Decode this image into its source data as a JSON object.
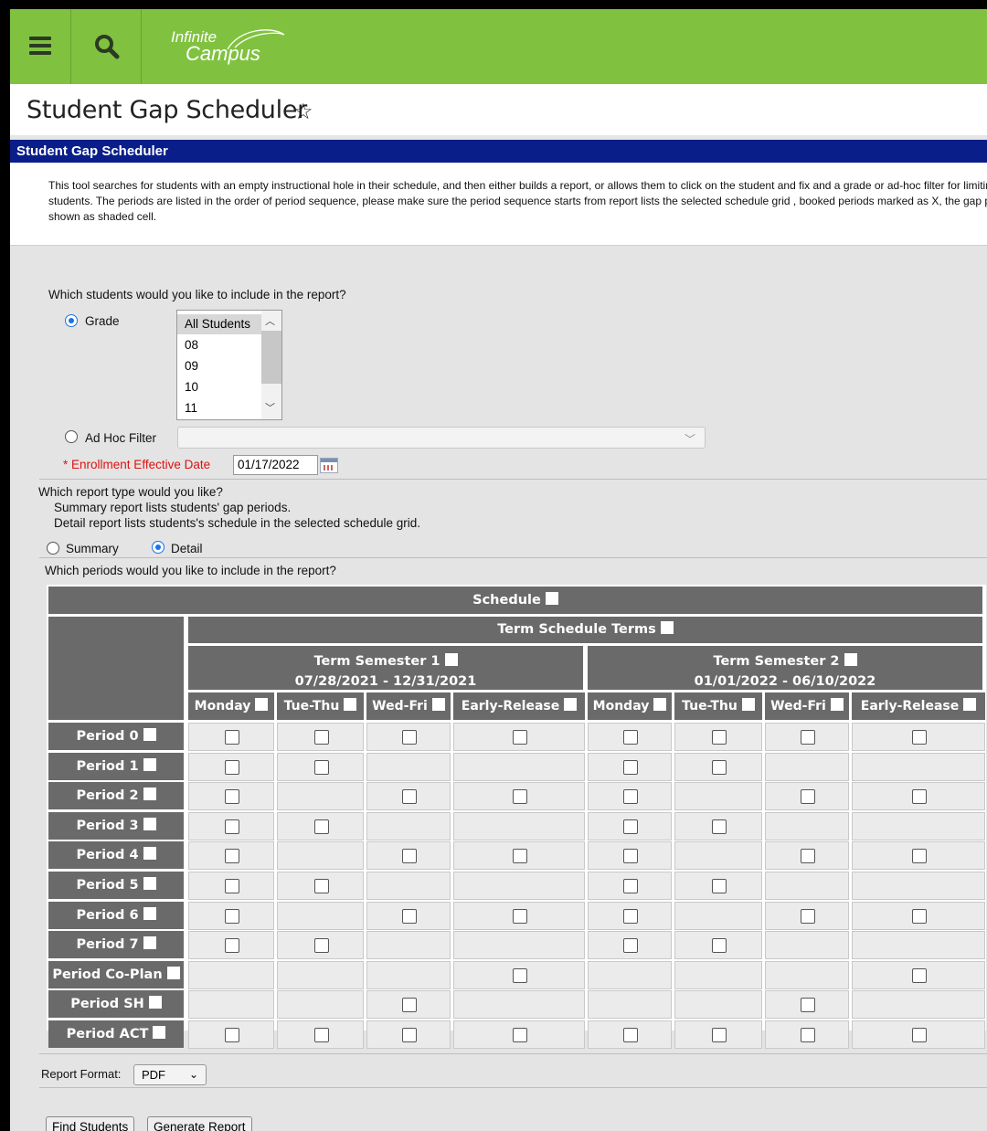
{
  "app": {
    "logo_line1": "Infinite",
    "logo_line2": "Campus"
  },
  "page": {
    "title": "Student Gap Scheduler",
    "section_header": "Student Gap Scheduler",
    "description": "This tool searches for students with an empty instructional hole in their schedule, and then either builds a report, or allows them to click on the student and fix and a grade or ad-hoc filter for limiting the students. The periods are listed in the order of period sequence, please make sure the period sequence starts from report lists the selected schedule grid , booked periods marked as X, the gap periods shown as shaded cell."
  },
  "students": {
    "question": "Which students would you like to include in the report?",
    "grade_label": "Grade",
    "grade_options": [
      "All Students",
      "08",
      "09",
      "10",
      "11"
    ],
    "grade_selected": "All Students",
    "adhoc_label": "Ad Hoc Filter",
    "adhoc_value": "",
    "required_mark": "*",
    "date_label": "Enrollment Effective Date",
    "date_value": "01/17/2022"
  },
  "report_type": {
    "question": "Which report type would you like?",
    "summary_desc": "Summary report lists students' gap periods.",
    "detail_desc": "Detail report lists students's schedule in the selected schedule grid.",
    "summary_label": "Summary",
    "detail_label": "Detail",
    "selected": "Detail"
  },
  "periods": {
    "question": "Which periods would you like to include in the report?",
    "schedule_label": "Schedule",
    "terms_label": "Term Schedule Terms",
    "terms": [
      {
        "label": "Term Semester 1",
        "dates": "07/28/2021 - 12/31/2021"
      },
      {
        "label": "Term Semester 2",
        "dates": "01/01/2022 - 06/10/2022"
      }
    ],
    "days": [
      "Monday",
      "Tue-Thu",
      "Wed-Fri",
      "Early-Release",
      "Monday",
      "Tue-Thu",
      "Wed-Fri",
      "Early-Release"
    ],
    "rows": [
      {
        "label": "Period 0",
        "cells": [
          1,
          1,
          1,
          1,
          1,
          1,
          1,
          1
        ]
      },
      {
        "label": "Period 1",
        "cells": [
          1,
          1,
          0,
          0,
          1,
          1,
          0,
          0
        ]
      },
      {
        "label": "Period 2",
        "cells": [
          1,
          0,
          1,
          1,
          1,
          0,
          1,
          1
        ]
      },
      {
        "label": "Period 3",
        "cells": [
          1,
          1,
          0,
          0,
          1,
          1,
          0,
          0
        ]
      },
      {
        "label": "Period 4",
        "cells": [
          1,
          0,
          1,
          1,
          1,
          0,
          1,
          1
        ]
      },
      {
        "label": "Period 5",
        "cells": [
          1,
          1,
          0,
          0,
          1,
          1,
          0,
          0
        ]
      },
      {
        "label": "Period 6",
        "cells": [
          1,
          0,
          1,
          1,
          1,
          0,
          1,
          1
        ]
      },
      {
        "label": "Period 7",
        "cells": [
          1,
          1,
          0,
          0,
          1,
          1,
          0,
          0
        ]
      },
      {
        "label": "Period Co-Plan",
        "cells": [
          0,
          0,
          0,
          1,
          0,
          0,
          0,
          1
        ]
      },
      {
        "label": "Period SH",
        "cells": [
          0,
          0,
          1,
          0,
          0,
          0,
          1,
          0
        ]
      },
      {
        "label": "Period ACT",
        "cells": [
          1,
          1,
          1,
          1,
          1,
          1,
          1,
          1
        ]
      }
    ]
  },
  "report_format": {
    "label": "Report Format:",
    "value": "PDF"
  },
  "actions": {
    "find_label": "Find Students",
    "generate_label": "Generate Report"
  },
  "colors": {
    "topbar": "#80c23f",
    "section_header": "#0a1e8a",
    "grid_header": "#6a6a6a",
    "radio_accent": "#1a73e8",
    "required": "#e01010"
  }
}
